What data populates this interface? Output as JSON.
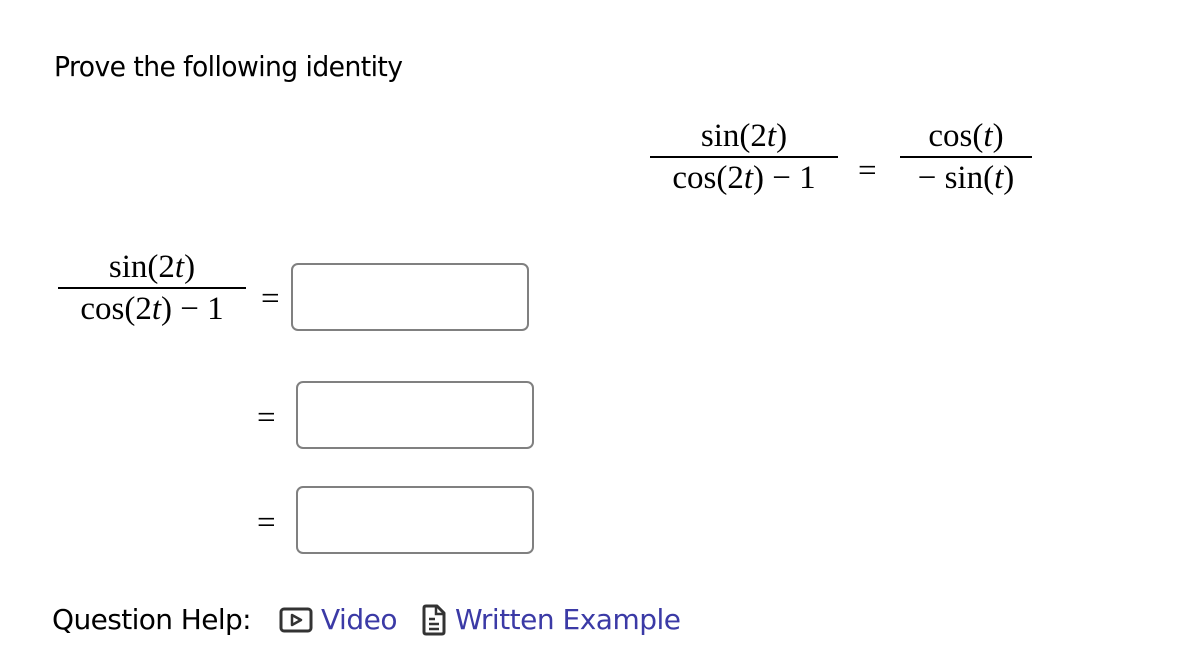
{
  "prompt": "Prove the following identity",
  "identity": {
    "lhs": {
      "numerator_fn": "sin",
      "numerator_arg_num": "2",
      "numerator_arg_var": "t",
      "denominator_fn": "cos",
      "denominator_arg_num": "2",
      "denominator_arg_var": "t",
      "denominator_tail": " − 1"
    },
    "equals": "=",
    "rhs": {
      "numerator_fn": "cos",
      "numerator_arg_var": "t",
      "denominator_prefix": "− ",
      "denominator_fn": "sin",
      "denominator_arg_var": "t"
    }
  },
  "work": {
    "start": {
      "numerator_fn": "sin",
      "numerator_arg_num": "2",
      "numerator_arg_var": "t",
      "denominator_fn": "cos",
      "denominator_arg_num": "2",
      "denominator_arg_var": "t",
      "denominator_tail": " − 1"
    },
    "steps": [
      {
        "equals": "=",
        "value": "",
        "placeholder": ""
      },
      {
        "equals": "=",
        "value": "",
        "placeholder": ""
      },
      {
        "equals": "=",
        "value": "",
        "placeholder": ""
      }
    ]
  },
  "help": {
    "label": "Question Help:",
    "links": [
      {
        "icon": "video-icon",
        "label": "Video"
      },
      {
        "icon": "document-icon",
        "label": "Written Example"
      }
    ],
    "link_color": "#3b3aa6"
  }
}
